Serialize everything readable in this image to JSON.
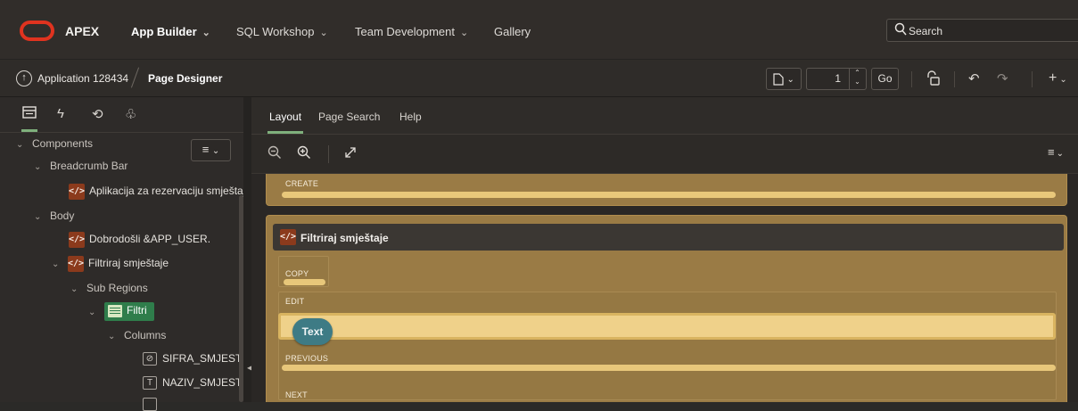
{
  "topnav": {
    "brand": "APEX",
    "items": [
      {
        "label": "App Builder",
        "chevron": "⌄"
      },
      {
        "label": "SQL Workshop",
        "chevron": "⌄"
      },
      {
        "label": "Team Development",
        "chevron": "⌄"
      },
      {
        "label": "Gallery"
      }
    ],
    "search_label": "Search",
    "colors": {
      "logo": "#e0331f",
      "background": "#312d2a"
    }
  },
  "breadcrumb": {
    "application": "Application 128434",
    "page": "Page Designer"
  },
  "toolbar": {
    "page_number": "1",
    "go_label": "Go",
    "add_label": "+"
  },
  "left_panel": {
    "tabs": [
      "rendering-icon",
      "dynamic-actions-icon",
      "processing-icon",
      "shared-components-icon"
    ],
    "tree": {
      "components": "Components",
      "breadcrumb_bar": "Breadcrumb Bar",
      "breadcrumb_region": "Aplikacija za rezervaciju smještaja",
      "body": "Body",
      "dobrodosli": "Dobrodošli &APP_USER.",
      "filtriraj": "Filtriraj smještaje",
      "sub_regions": "Sub Regions",
      "filtri": "Filtri",
      "columns": "Columns",
      "col1": "SIFRA_SMJESTAJA",
      "col2": "NAZIV_SMJESTAJA"
    }
  },
  "right_panel": {
    "tabs": {
      "layout": "Layout",
      "page_search": "Page Search",
      "help": "Help"
    },
    "canvas": {
      "create": "CREATE",
      "region_title": "Filtriraj smještaje",
      "copy": "COPY",
      "edit": "EDIT",
      "text_item": "Text",
      "previous": "PREVIOUS",
      "next": "NEXT"
    },
    "colors": {
      "region": "#9a7b45",
      "slot_bar": "#e8c77a",
      "text_pill": "#3e7b85"
    }
  }
}
